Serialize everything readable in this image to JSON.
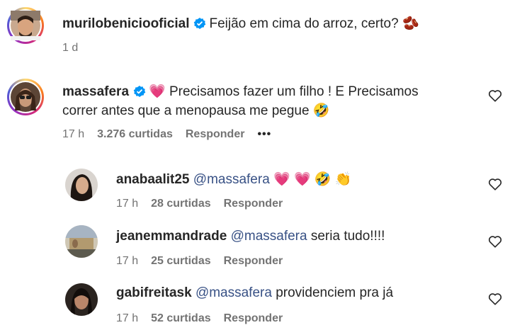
{
  "post": {
    "username": "murilobeniciooficial",
    "caption": "Feijão em cima do arroz, certo?",
    "caption_emoji": "🫘",
    "time": "1 d"
  },
  "comment": {
    "username": "massafera",
    "text_line1": "Precisamos fazer um filho ! E Precisamos",
    "text_line2": "correr antes que a menopausa me pegue",
    "lead_emoji": "💗",
    "trail_emoji": "🤣",
    "time": "17 h",
    "likes": "3.276 curtidas",
    "reply_label": "Responder",
    "more_label": "•••"
  },
  "replies": [
    {
      "username": "anabaalit25",
      "mention": "@massafera",
      "text": "",
      "emojis": "💗 💗 🤣 👏",
      "time": "17 h",
      "likes": "28 curtidas",
      "reply_label": "Responder"
    },
    {
      "username": "jeanemmandrade",
      "mention": "@massafera",
      "text": "seria tudo!!!!",
      "emojis": "",
      "time": "17 h",
      "likes": "25 curtidas",
      "reply_label": "Responder"
    },
    {
      "username": "gabifreitask",
      "mention": "@massafera",
      "text": "providenciem pra já",
      "emojis": "",
      "time": "17 h",
      "likes": "52 curtidas",
      "reply_label": "Responder"
    }
  ],
  "colors": {
    "verified": "#0095f6",
    "mention": "#385185",
    "muted": "#737373"
  }
}
